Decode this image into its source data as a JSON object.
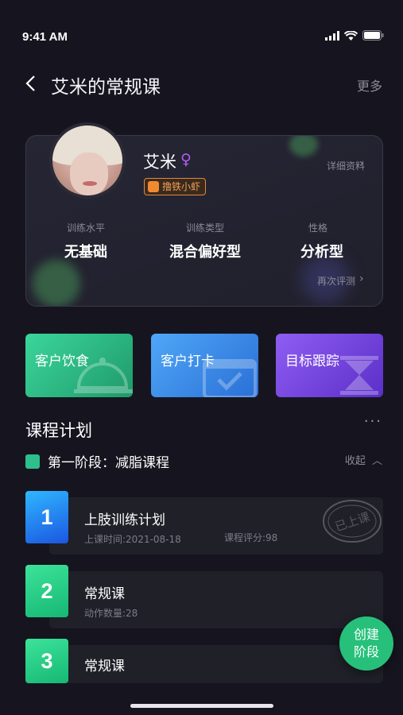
{
  "status": {
    "time": "9:41 AM"
  },
  "nav": {
    "title": "艾米的常规课",
    "more": "更多"
  },
  "profile": {
    "name": "艾米",
    "gender_symbol": "♀",
    "tag": "撸铁小虾",
    "detail_link": "详细资料",
    "stats": [
      {
        "label": "训练水平",
        "value": "无基础"
      },
      {
        "label": "训练类型",
        "value": "混合偏好型"
      },
      {
        "label": "性格",
        "value": "分析型"
      }
    ],
    "retest_link": "再次评测"
  },
  "quick": [
    {
      "label": "客户饮食",
      "icon": "cloche-icon",
      "color_from": "#3bd69b",
      "color_to": "#1f9a6a"
    },
    {
      "label": "客户打卡",
      "icon": "calendar-check-icon",
      "color_from": "#4fa7f7",
      "color_to": "#2a6fd6"
    },
    {
      "label": "目标跟踪",
      "icon": "hourglass-icon",
      "color_from": "#8f5df2",
      "color_to": "#5b2fc9"
    }
  ],
  "plan": {
    "title": "课程计划",
    "more": "···",
    "stage": "第一阶段：减脂课程",
    "collapse": "收起",
    "courses": [
      {
        "num": "1",
        "title": "上肢训练计划",
        "meta": "上课时间:2021-08-18",
        "score": "课程评分:98",
        "stamp": "已上课"
      },
      {
        "num": "2",
        "title": "常规课",
        "meta": "动作数量:28"
      },
      {
        "num": "3",
        "title": "常规课"
      }
    ]
  },
  "fab": {
    "line1": "创建",
    "line2": "阶段"
  }
}
